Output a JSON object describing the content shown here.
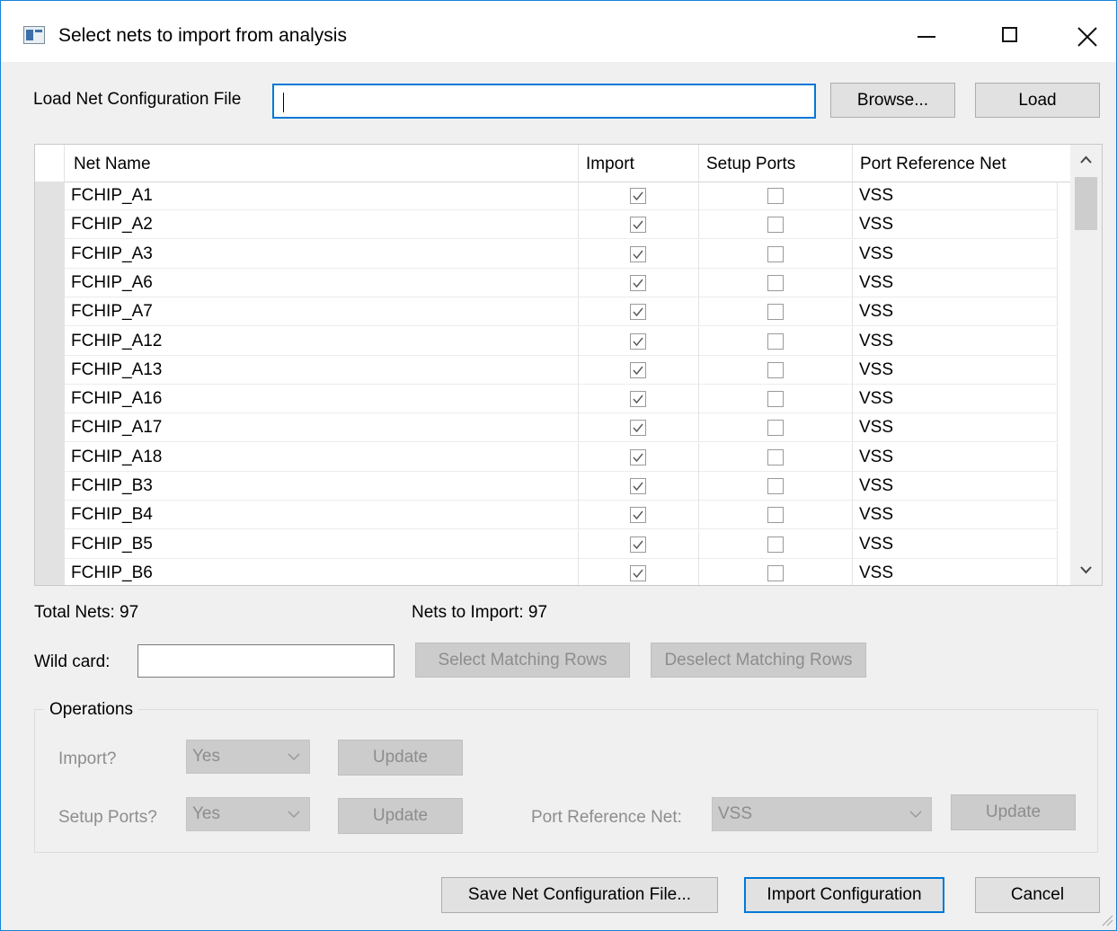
{
  "window": {
    "title": "Select nets to import from analysis"
  },
  "load_file": {
    "label": "Load Net Configuration File",
    "value": "",
    "browse_label": "Browse...",
    "load_label": "Load"
  },
  "table": {
    "columns": [
      "Net Name",
      "Import",
      "Setup Ports",
      "Port Reference Net"
    ],
    "rows": [
      {
        "name": "FCHIP_A1",
        "import": true,
        "setup": false,
        "ref": "VSS"
      },
      {
        "name": "FCHIP_A2",
        "import": true,
        "setup": false,
        "ref": "VSS"
      },
      {
        "name": "FCHIP_A3",
        "import": true,
        "setup": false,
        "ref": "VSS"
      },
      {
        "name": "FCHIP_A6",
        "import": true,
        "setup": false,
        "ref": "VSS"
      },
      {
        "name": "FCHIP_A7",
        "import": true,
        "setup": false,
        "ref": "VSS"
      },
      {
        "name": "FCHIP_A12",
        "import": true,
        "setup": false,
        "ref": "VSS"
      },
      {
        "name": "FCHIP_A13",
        "import": true,
        "setup": false,
        "ref": "VSS"
      },
      {
        "name": "FCHIP_A16",
        "import": true,
        "setup": false,
        "ref": "VSS"
      },
      {
        "name": "FCHIP_A17",
        "import": true,
        "setup": false,
        "ref": "VSS"
      },
      {
        "name": "FCHIP_A18",
        "import": true,
        "setup": false,
        "ref": "VSS"
      },
      {
        "name": "FCHIP_B3",
        "import": true,
        "setup": false,
        "ref": "VSS"
      },
      {
        "name": "FCHIP_B4",
        "import": true,
        "setup": false,
        "ref": "VSS"
      },
      {
        "name": "FCHIP_B5",
        "import": true,
        "setup": false,
        "ref": "VSS"
      },
      {
        "name": "FCHIP_B6",
        "import": true,
        "setup": false,
        "ref": "VSS"
      }
    ]
  },
  "summary": {
    "total_nets": "Total Nets: 97",
    "nets_to_import": "Nets to Import: 97"
  },
  "wildcard": {
    "label": "Wild card:",
    "value": "",
    "select_label": "Select Matching Rows",
    "deselect_label": "Deselect Matching Rows"
  },
  "operations": {
    "title": "Operations",
    "import_label": "Import?",
    "import_value": "Yes",
    "setup_label": "Setup Ports?",
    "setup_value": "Yes",
    "ref_label": "Port Reference Net:",
    "ref_value": "VSS",
    "update_label": "Update"
  },
  "footer": {
    "save_label": "Save Net Configuration File...",
    "import_label": "Import Configuration",
    "cancel_label": "Cancel"
  },
  "colors": {
    "accent": "#0078d7",
    "window_border": "#1883d7",
    "disabled_text": "#8d8d8d"
  }
}
